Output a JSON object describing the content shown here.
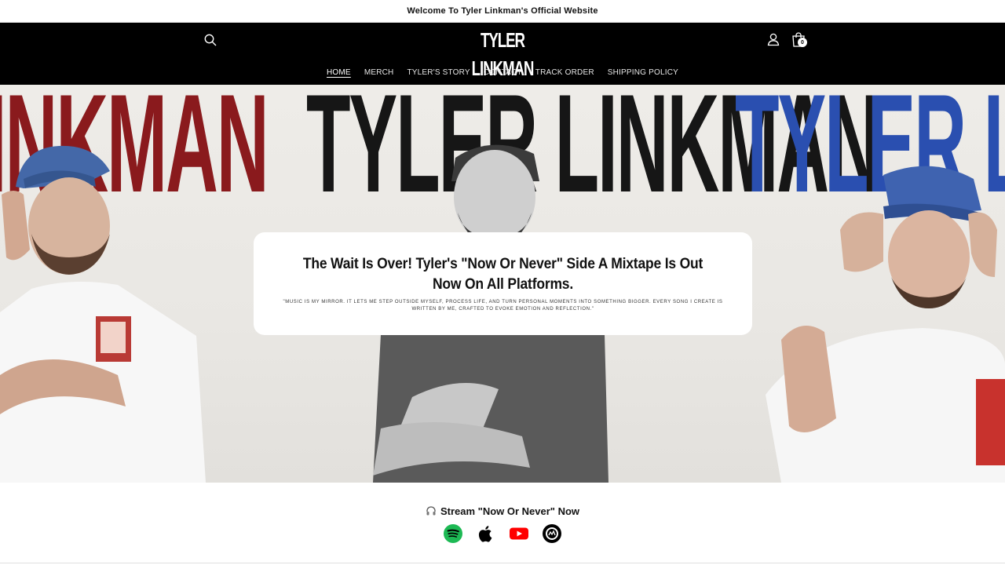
{
  "announcement": "Welcome To Tyler Linkman's Official Website",
  "header": {
    "logo": "TYLER LINKMAN",
    "cart_count": "0",
    "icons": {
      "search": "search-icon",
      "account": "account-icon",
      "cart": "cart-icon"
    }
  },
  "nav": [
    {
      "label": "HOME",
      "active": true
    },
    {
      "label": "MERCH"
    },
    {
      "label": "TYLER'S STORY"
    },
    {
      "label": "CONTACT"
    },
    {
      "label": "TRACK ORDER"
    },
    {
      "label": "SHIPPING POLICY"
    }
  ],
  "hero": {
    "banner_words": [
      "R LINKMAN",
      "TYLER LINKMAN",
      "TYLER LINK"
    ],
    "banner_colors": {
      "red": "#8a1a1d",
      "black": "#161616",
      "blue": "#2a4fb0"
    },
    "title": "The Wait Is Over! Tyler's \"Now Or Never\" Side A Mixtape Is Out Now On All Platforms.",
    "quote": "\"Music is my mirror. It lets me step outside myself, process life, and turn personal moments into something bigger. Every song I create is written by me, crafted to evoke emotion and reflection.\""
  },
  "stream": {
    "label": "Stream \"Now Or Never\" Now",
    "platforms": [
      "spotify-icon",
      "apple-icon",
      "youtube-icon",
      "audiomack-icon"
    ]
  }
}
